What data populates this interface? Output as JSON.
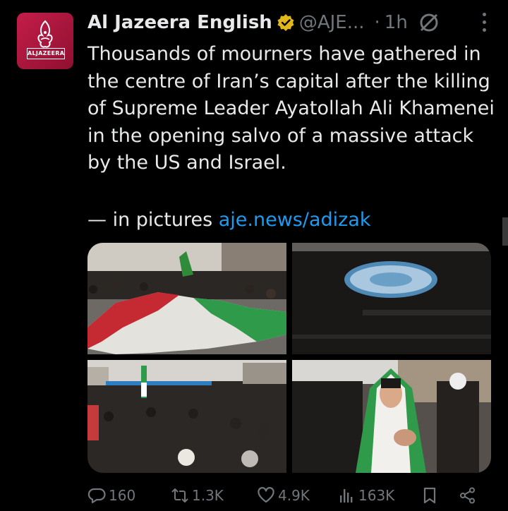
{
  "post": {
    "author_name": "Al Jazeera English",
    "handle": "@AJE...",
    "separator": "·",
    "time": "1h",
    "avatar_brand_text": "ALJAZEERA",
    "text": "Thousands of mourners have gathered in the centre of Iran’s capital after the killing of Supreme Leader Ayatollah Ali Khamenei in the opening salvo of a massive attack by the US and Israel.",
    "pictures_prefix": "— in pictures",
    "link": "aje.news/adizak"
  },
  "actions": {
    "replies": "160",
    "reposts": "1.3K",
    "likes": "4.9K",
    "views": "163K"
  },
  "icons": {
    "verified": "verified-badge-icon",
    "grok": "no-sign-icon",
    "more": "more-icon",
    "reply": "reply-icon",
    "repost": "repost-icon",
    "like": "heart-icon",
    "views": "views-icon",
    "bookmark": "bookmark-icon",
    "share": "share-icon"
  },
  "colors": {
    "background": "#000000",
    "text": "#e7e9ea",
    "muted": "#71767b",
    "link": "#1d9bf0",
    "verified_gold": "#e2b719",
    "avatar": "#c41d4a"
  }
}
